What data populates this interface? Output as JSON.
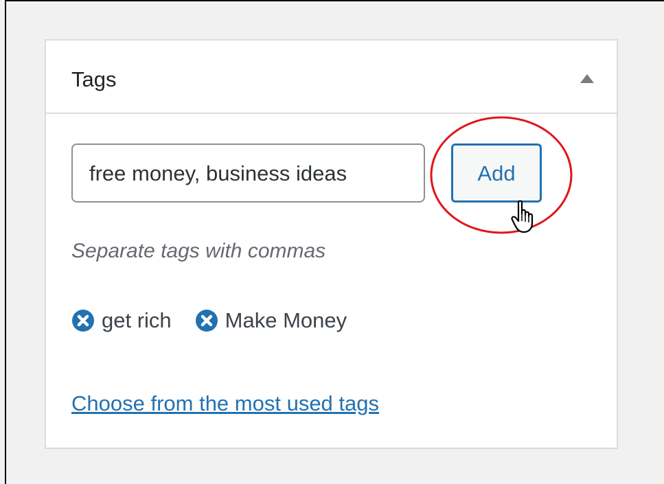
{
  "panel": {
    "title": "Tags",
    "toggle_icon": "triangle-up-icon"
  },
  "tag_input": {
    "value": "free money, business ideas",
    "add_label": "Add"
  },
  "hint": "Separate tags with commas",
  "tags": [
    {
      "label": "get rich",
      "remove_icon": "remove-tag-icon"
    },
    {
      "label": "Make Money",
      "remove_icon": "remove-tag-icon"
    }
  ],
  "most_used_link": "Choose from the most used tags",
  "colors": {
    "accent": "#2271b1",
    "annotation": "#e0161b",
    "panel_border": "#dcdcde",
    "background": "#f1f1f1"
  }
}
